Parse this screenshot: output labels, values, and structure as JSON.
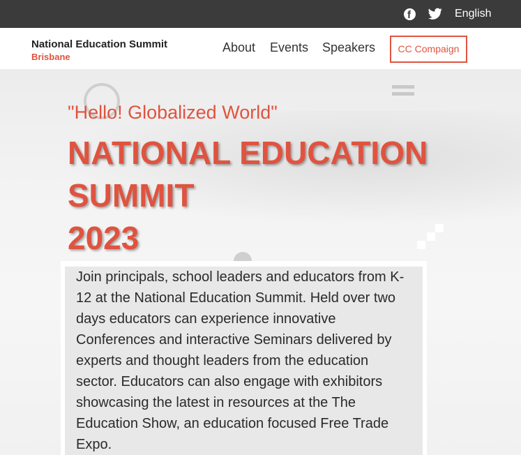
{
  "topbar": {
    "facebook_icon": "facebook-icon",
    "twitter_icon": "twitter-icon",
    "language": "English"
  },
  "navbar": {
    "brand_title": "National Education Summit",
    "brand_subtitle": "Brisbane",
    "links": [
      "About",
      "Events",
      "Speakers"
    ],
    "cta_label": "CC Compaign"
  },
  "hero": {
    "tagline": "\"Hello! Globalized World\"",
    "headline_line1": "NATIONAL EDUCATION",
    "headline_line2": "SUMMIT",
    "headline_line3": "2023",
    "description": "Join principals, school leaders and educators from K-12 at the National Education Summit. Held over two days educators can experience innovative Conferences and interactive Seminars delivered by experts and thought leaders from the education sector. Educators can also engage with exhibitors showcasing the latest in resources at the The Education Show, an education focused Free Trade Expo."
  },
  "colors": {
    "accent": "#e0533f",
    "topbar_bg": "#3b3b3b",
    "nav_bg": "#ffffff"
  }
}
